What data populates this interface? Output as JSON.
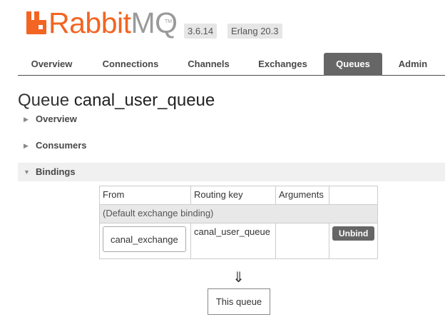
{
  "header": {
    "logo_rabbit": "Rabbit",
    "logo_mq": "MQ",
    "logo_tm": "TM",
    "version": "3.6.14",
    "erlang": "Erlang 20.3"
  },
  "nav": {
    "tabs": [
      {
        "label": "Overview",
        "active": false
      },
      {
        "label": "Connections",
        "active": false
      },
      {
        "label": "Channels",
        "active": false
      },
      {
        "label": "Exchanges",
        "active": false
      },
      {
        "label": "Queues",
        "active": true
      },
      {
        "label": "Admin",
        "active": false
      }
    ]
  },
  "page": {
    "title_prefix": "Queue",
    "queue_name": "canal_user_queue"
  },
  "sections": {
    "overview": "Overview",
    "consumers": "Consumers",
    "bindings": "Bindings"
  },
  "bindings": {
    "headers": {
      "from": "From",
      "routing_key": "Routing key",
      "arguments": "Arguments"
    },
    "default_binding": "(Default exchange binding)",
    "rows": [
      {
        "from": "canal_exchange",
        "routing_key": "canal_user_queue",
        "arguments": "",
        "action": "Unbind"
      }
    ],
    "arrow": "⇓",
    "this_queue": "This queue"
  },
  "colors": {
    "brand_orange": "#f26522",
    "active_tab": "#666666"
  }
}
